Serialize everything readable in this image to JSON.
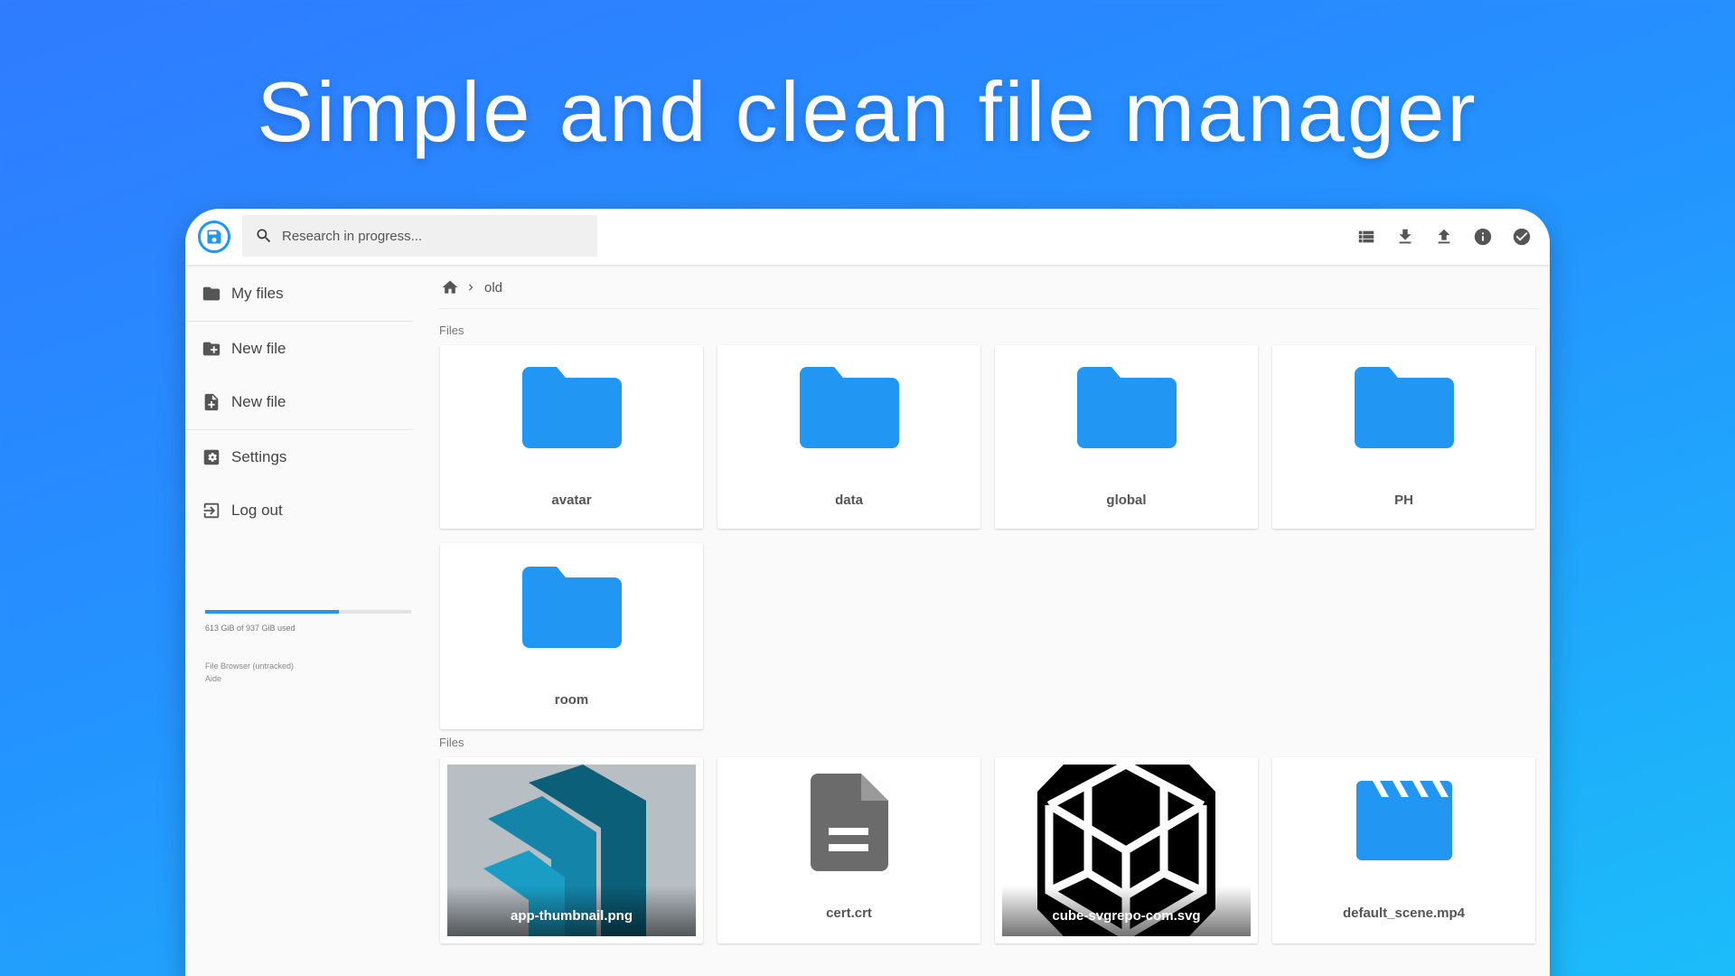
{
  "hero": {
    "title": "Simple and clean file manager"
  },
  "search": {
    "placeholder": "Research in progress..."
  },
  "header_actions": [
    {
      "name": "list-view-button",
      "icon": "view-list-icon"
    },
    {
      "name": "download-button",
      "icon": "download-icon"
    },
    {
      "name": "upload-button",
      "icon": "upload-icon"
    },
    {
      "name": "info-button",
      "icon": "info-icon"
    },
    {
      "name": "select-button",
      "icon": "check-circle-icon"
    }
  ],
  "sidebar": {
    "items": [
      {
        "label": "My files",
        "icon": "folder-icon"
      },
      {
        "label": "New file",
        "icon": "folder-plus-icon"
      },
      {
        "label": "New file",
        "icon": "file-plus-icon"
      },
      {
        "label": "Settings",
        "icon": "gear-icon"
      },
      {
        "label": "Log out",
        "icon": "logout-icon"
      }
    ],
    "usage": {
      "text": "613 GiB of 937 GiB used",
      "fraction": 0.65
    },
    "credit_line1": "File Browser (untracked)",
    "credit_line2": "Aide"
  },
  "breadcrumb": {
    "current": "old"
  },
  "sections": {
    "folders_label": "Files",
    "files_label": "Files"
  },
  "folders": [
    {
      "name": "avatar"
    },
    {
      "name": "data"
    },
    {
      "name": "global"
    },
    {
      "name": "PH"
    },
    {
      "name": "room"
    }
  ],
  "files": [
    {
      "name": "app-thumbnail.png",
      "kind": "image"
    },
    {
      "name": "cert.crt",
      "kind": "document"
    },
    {
      "name": "cube-svgrepo-com.svg",
      "kind": "image"
    },
    {
      "name": "default_scene.mp4",
      "kind": "video"
    }
  ],
  "colors": {
    "accent": "#2196f3",
    "folder": "#2196f3",
    "doc_icon": "#6b6b6b"
  }
}
